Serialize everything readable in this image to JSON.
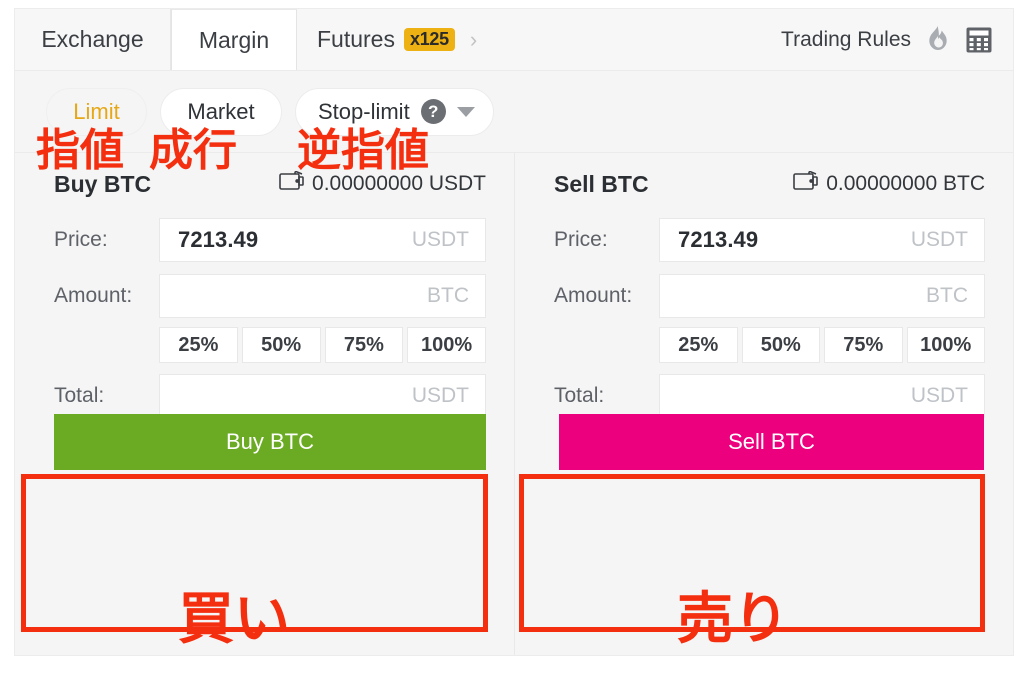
{
  "tabs": [
    {
      "label": "Exchange",
      "active": false
    },
    {
      "label": "Margin",
      "active": true
    },
    {
      "label": "Futures",
      "badge": "x125",
      "active": false
    }
  ],
  "header": {
    "trading_rules": "Trading Rules",
    "flame_icon": "flame-icon",
    "calculator_icon": "calculator-icon",
    "chevron_right_icon": "chevron-right-icon"
  },
  "order_types": {
    "limit": "Limit",
    "market": "Market",
    "stop_limit": "Stop-limit",
    "help_icon": "question-mark-icon",
    "dropdown_icon": "chevron-down-icon",
    "active": "Limit",
    "active_color": "#e6a817"
  },
  "buy_panel": {
    "title": "Buy BTC",
    "wallet_icon": "wallet-icon",
    "balance": "0.00000000 USDT",
    "fields": [
      {
        "label": "Price:",
        "value": "7213.49",
        "placeholder": "",
        "unit": "USDT"
      },
      {
        "label": "Amount:",
        "value": "",
        "placeholder": "",
        "unit": "BTC"
      }
    ],
    "percents": [
      "25%",
      "50%",
      "75%",
      "100%"
    ],
    "total": {
      "label": "Total:",
      "value": "",
      "placeholder": "",
      "unit": "USDT"
    },
    "action_label": "Buy BTC",
    "action_color": "#6aab23"
  },
  "sell_panel": {
    "title": "Sell BTC",
    "wallet_icon": "wallet-icon",
    "balance": "0.00000000 BTC",
    "fields": [
      {
        "label": "Price:",
        "value": "7213.49",
        "placeholder": "",
        "unit": "USDT"
      },
      {
        "label": "Amount:",
        "value": "",
        "placeholder": "",
        "unit": "BTC"
      }
    ],
    "percents": [
      "25%",
      "50%",
      "75%",
      "100%"
    ],
    "total": {
      "label": "Total:",
      "value": "",
      "placeholder": "",
      "unit": "USDT"
    },
    "action_label": "Sell BTC",
    "action_color": "#ed007e"
  },
  "annotations": {
    "color": "#f42f10",
    "limit": "指値",
    "market": "成行",
    "stop_limit": "逆指値",
    "buy": "買い",
    "sell": "売り"
  }
}
